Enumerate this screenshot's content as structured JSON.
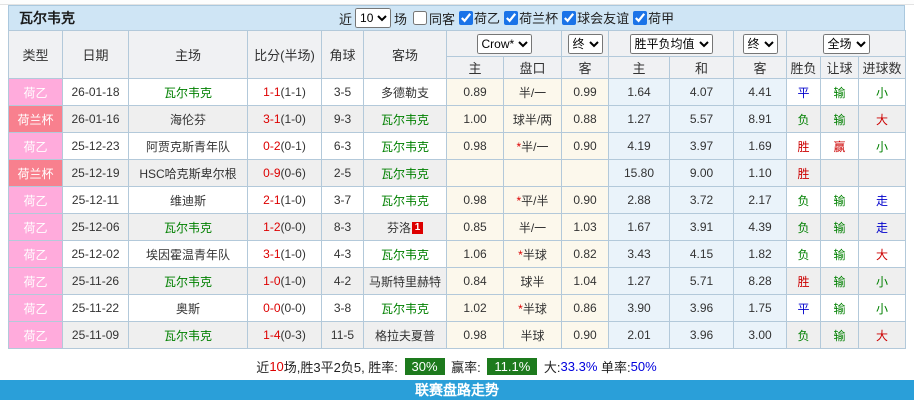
{
  "title": "瓦尔韦克",
  "filters": {
    "recent_label": "近",
    "recent_value": "10",
    "matches_label": "场",
    "same_venue": {
      "label": "同客",
      "checked": false
    },
    "leagues": [
      {
        "label": "荷乙",
        "checked": true
      },
      {
        "label": "荷兰杯",
        "checked": true
      },
      {
        "label": "球会友谊",
        "checked": true
      },
      {
        "label": "荷甲",
        "checked": true
      }
    ]
  },
  "header": {
    "col_type": "类型",
    "col_date": "日期",
    "col_home": "主场",
    "col_score": "比分(半场)",
    "col_corner": "角球",
    "col_away": "客场",
    "odds_select": "Crow*",
    "odds_final": "终",
    "mean_select": "胜平负均值",
    "mean_final": "终",
    "scope_select": "全场",
    "sub": {
      "home": "主",
      "handicap": "盘口",
      "away": "客",
      "m_home": "主",
      "m_draw": "和",
      "m_away": "客",
      "result": "胜负",
      "handicap_res": "让球",
      "goals": "进球数"
    }
  },
  "colors": {
    "accent_blue": "#2a9fd9",
    "pink_badge": "#ffabdc",
    "red_badge": "#f8808e",
    "win_red": "#cc0000",
    "draw_blue": "#0000cc",
    "lose_green": "#008000",
    "summary_green": "#1d7a1d"
  },
  "rows": [
    {
      "league": "荷乙",
      "league_color": "pink",
      "date": "26-01-18",
      "home": "瓦尔韦克",
      "home_self": true,
      "score": "1-1",
      "half": "(1-1)",
      "corners": "3-5",
      "away": "多德勒支",
      "away_self": false,
      "away_card": "",
      "odds_home": "0.89",
      "handicap_star": false,
      "handicap": "半/一",
      "odds_away": "0.99",
      "mean_home": "1.64",
      "mean_draw": "4.07",
      "mean_away": "4.41",
      "result": {
        "text": "平",
        "color": "blue"
      },
      "handicap_result": {
        "text": "输",
        "color": "green"
      },
      "goals": {
        "text": "小",
        "color": "green"
      }
    },
    {
      "league": "荷兰杯",
      "league_color": "redpink",
      "date": "26-01-16",
      "home": "海伦芬",
      "home_self": false,
      "score": "3-1",
      "half": "(1-0)",
      "corners": "9-3",
      "away": "瓦尔韦克",
      "away_self": true,
      "away_card": "",
      "odds_home": "1.00",
      "handicap_star": false,
      "handicap": "球半/两",
      "odds_away": "0.88",
      "mean_home": "1.27",
      "mean_draw": "5.57",
      "mean_away": "8.91",
      "result": {
        "text": "负",
        "color": "green"
      },
      "handicap_result": {
        "text": "输",
        "color": "green"
      },
      "goals": {
        "text": "大",
        "color": "red"
      }
    },
    {
      "league": "荷乙",
      "league_color": "pink",
      "date": "25-12-23",
      "home": "阿贾克斯青年队",
      "home_self": false,
      "score": "0-2",
      "half": "(0-1)",
      "corners": "6-3",
      "away": "瓦尔韦克",
      "away_self": true,
      "away_card": "",
      "odds_home": "0.98",
      "handicap_star": true,
      "handicap": "半/一",
      "odds_away": "0.90",
      "mean_home": "4.19",
      "mean_draw": "3.97",
      "mean_away": "1.69",
      "result": {
        "text": "胜",
        "color": "red"
      },
      "handicap_result": {
        "text": "赢",
        "color": "red"
      },
      "goals": {
        "text": "小",
        "color": "green"
      }
    },
    {
      "league": "荷兰杯",
      "league_color": "redpink",
      "date": "25-12-19",
      "home": "HSC哈克斯卑尔根",
      "home_self": false,
      "score": "0-9",
      "half": "(0-6)",
      "corners": "2-5",
      "away": "瓦尔韦克",
      "away_self": true,
      "away_card": "",
      "odds_home": "",
      "handicap_star": false,
      "handicap": "",
      "odds_away": "",
      "mean_home": "15.80",
      "mean_draw": "9.00",
      "mean_away": "1.10",
      "result": {
        "text": "胜",
        "color": "red"
      },
      "handicap_result": null,
      "goals": null
    },
    {
      "league": "荷乙",
      "league_color": "pink",
      "date": "25-12-11",
      "home": "维迪斯",
      "home_self": false,
      "score": "2-1",
      "half": "(1-0)",
      "corners": "3-7",
      "away": "瓦尔韦克",
      "away_self": true,
      "away_card": "",
      "odds_home": "0.98",
      "handicap_star": true,
      "handicap": "平/半",
      "odds_away": "0.90",
      "mean_home": "2.88",
      "mean_draw": "3.72",
      "mean_away": "2.17",
      "result": {
        "text": "负",
        "color": "green"
      },
      "handicap_result": {
        "text": "输",
        "color": "green"
      },
      "goals": {
        "text": "走",
        "color": "blue"
      }
    },
    {
      "league": "荷乙",
      "league_color": "pink",
      "date": "25-12-06",
      "home": "瓦尔韦克",
      "home_self": true,
      "score": "1-2",
      "half": "(0-0)",
      "corners": "8-3",
      "away": "芬洛",
      "away_self": false,
      "away_card": "1",
      "odds_home": "0.85",
      "handicap_star": false,
      "handicap": "半/一",
      "odds_away": "1.03",
      "mean_home": "1.67",
      "mean_draw": "3.91",
      "mean_away": "4.39",
      "result": {
        "text": "负",
        "color": "green"
      },
      "handicap_result": {
        "text": "输",
        "color": "green"
      },
      "goals": {
        "text": "走",
        "color": "blue"
      }
    },
    {
      "league": "荷乙",
      "league_color": "pink",
      "date": "25-12-02",
      "home": "埃因霍温青年队",
      "home_self": false,
      "score": "3-1",
      "half": "(1-0)",
      "corners": "4-3",
      "away": "瓦尔韦克",
      "away_self": true,
      "away_card": "",
      "odds_home": "1.06",
      "handicap_star": true,
      "handicap": "半球",
      "odds_away": "0.82",
      "mean_home": "3.43",
      "mean_draw": "4.15",
      "mean_away": "1.82",
      "result": {
        "text": "负",
        "color": "green"
      },
      "handicap_result": {
        "text": "输",
        "color": "green"
      },
      "goals": {
        "text": "大",
        "color": "red"
      }
    },
    {
      "league": "荷乙",
      "league_color": "pink",
      "date": "25-11-26",
      "home": "瓦尔韦克",
      "home_self": true,
      "score": "1-0",
      "half": "(1-0)",
      "corners": "4-2",
      "away": "马斯特里赫特",
      "away_self": false,
      "away_card": "",
      "odds_home": "0.84",
      "handicap_star": false,
      "handicap": "球半",
      "odds_away": "1.04",
      "mean_home": "1.27",
      "mean_draw": "5.71",
      "mean_away": "8.28",
      "result": {
        "text": "胜",
        "color": "red"
      },
      "handicap_result": {
        "text": "输",
        "color": "green"
      },
      "goals": {
        "text": "小",
        "color": "green"
      }
    },
    {
      "league": "荷乙",
      "league_color": "pink",
      "date": "25-11-22",
      "home": "奥斯",
      "home_self": false,
      "score": "0-0",
      "half": "(0-0)",
      "corners": "3-8",
      "away": "瓦尔韦克",
      "away_self": true,
      "away_card": "",
      "odds_home": "1.02",
      "handicap_star": true,
      "handicap": "半球",
      "odds_away": "0.86",
      "mean_home": "3.90",
      "mean_draw": "3.96",
      "mean_away": "1.75",
      "result": {
        "text": "平",
        "color": "blue"
      },
      "handicap_result": {
        "text": "输",
        "color": "green"
      },
      "goals": {
        "text": "小",
        "color": "green"
      }
    },
    {
      "league": "荷乙",
      "league_color": "pink",
      "date": "25-11-09",
      "home": "瓦尔韦克",
      "home_self": true,
      "score": "1-4",
      "half": "(0-3)",
      "corners": "11-5",
      "away": "格拉夫夏普",
      "away_self": false,
      "away_card": "",
      "odds_home": "0.98",
      "handicap_star": false,
      "handicap": "半球",
      "odds_away": "0.90",
      "mean_home": "2.01",
      "mean_draw": "3.96",
      "mean_away": "3.00",
      "result": {
        "text": "负",
        "color": "green"
      },
      "handicap_result": {
        "text": "输",
        "color": "green"
      },
      "goals": {
        "text": "大",
        "color": "red"
      }
    }
  ],
  "summary": {
    "prefix": "近",
    "count": "10",
    "middle": "场,胜3平2负5, 胜率: ",
    "win_rate": "30%",
    "profit_label": " 赢率: ",
    "profit_rate": "11.1%",
    "big_label": " 大:",
    "big_rate": "33.3%",
    "single_label": " 单率:",
    "single_rate": "50%"
  },
  "footer": {
    "title": "联赛盘路走势"
  }
}
